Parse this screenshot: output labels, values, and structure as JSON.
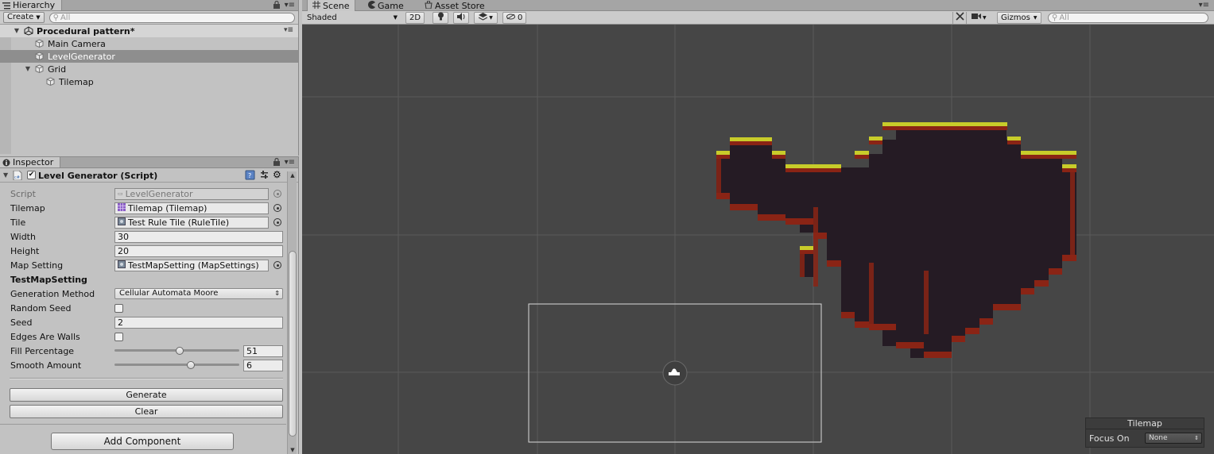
{
  "hierarchy": {
    "tab_label": "Hierarchy",
    "create_label": "Create",
    "search_placeholder": "All",
    "scene_name": "Procedural pattern*",
    "items": [
      {
        "label": "Main Camera"
      },
      {
        "label": "LevelGenerator"
      },
      {
        "label": "Grid"
      },
      {
        "label": "Tilemap"
      }
    ]
  },
  "inspector": {
    "tab_label": "Inspector",
    "component_title": "Level Generator (Script)",
    "component_enabled": true,
    "fields": {
      "script_label": "Script",
      "script_value": "LevelGenerator",
      "tilemap_label": "Tilemap",
      "tilemap_value": "Tilemap (Tilemap)",
      "tile_label": "Tile",
      "tile_value": "Test Rule Tile (RuleTile)",
      "width_label": "Width",
      "width_value": "30",
      "height_label": "Height",
      "height_value": "20",
      "map_setting_label": "Map Setting",
      "map_setting_value": "TestMapSetting (MapSettings)",
      "section_title": "TestMapSetting",
      "generation_method_label": "Generation Method",
      "generation_method_value": "Cellular Automata Moore",
      "random_seed_label": "Random Seed",
      "random_seed_checked": false,
      "seed_label": "Seed",
      "seed_value": "2",
      "edges_are_walls_label": "Edges Are Walls",
      "edges_are_walls_checked": false,
      "fill_percentage_label": "Fill Percentage",
      "fill_percentage_value": "51",
      "fill_percentage_slider": 0.51,
      "smooth_amount_label": "Smooth Amount",
      "smooth_amount_value": "6",
      "smooth_amount_slider": 0.6
    },
    "generate_label": "Generate",
    "clear_label": "Clear",
    "add_component_label": "Add Component"
  },
  "scene": {
    "tabs": [
      {
        "label": "Scene",
        "icon": "grid-icon"
      },
      {
        "label": "Game",
        "icon": "pacman-icon"
      },
      {
        "label": "Asset Store",
        "icon": "store-icon"
      }
    ],
    "shading_mode": "Shaded",
    "mode_2d_label": "2D",
    "hidden_count": "0",
    "gizmos_label": "Gizmos",
    "search_placeholder": "All",
    "overlay": {
      "title": "Tilemap",
      "focus_label": "Focus On",
      "focus_value": "None"
    }
  },
  "colors": {
    "scene_bg": "#464646",
    "cave_fill": "#251b24",
    "edge_red": "#8a2415",
    "grass": "#c8cc2a",
    "selection": "#8e8e8e"
  }
}
